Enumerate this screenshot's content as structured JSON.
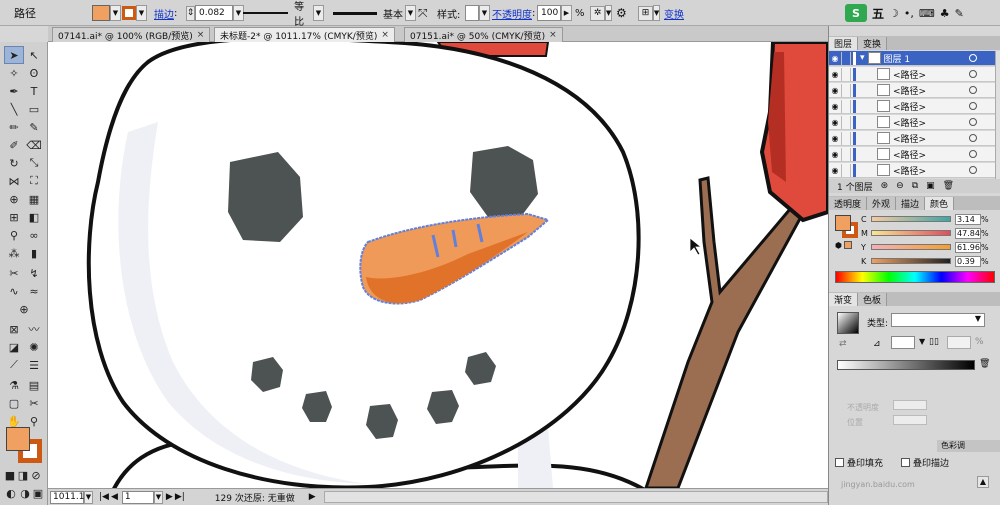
{
  "control_bar": {
    "object_type": "路径",
    "fill_color": "#f0a060",
    "stroke_color": "#cc5a14",
    "stroke_link": "描边",
    "stroke_weight": "0.082",
    "profile_label": "等比",
    "brush_label": "基本",
    "style_label": "样式:",
    "opacity_link": "不透明度",
    "opacity_value": "100",
    "opacity_unit": "%",
    "transform_link": "变换"
  },
  "ime": {
    "logo": "S",
    "mode": "五"
  },
  "doc_tabs": [
    {
      "label": "07141.ai* @ 100% (RGB/预览)",
      "close": "×",
      "active": false
    },
    {
      "label": "未标题-2* @ 1011.17% (CMYK/预览)",
      "close": "×",
      "active": true
    },
    {
      "label": "07151.ai* @ 50% (CMYK/预览)",
      "close": "×",
      "active": false
    }
  ],
  "layers_panel": {
    "tabs": [
      "图层",
      "变换"
    ],
    "top_layer": "图层 1",
    "rows": [
      "<路径>",
      "<路径>",
      "<路径>",
      "<路径>",
      "<路径>",
      "<路径>",
      "<路径>"
    ],
    "footer": "1 个图层"
  },
  "color_panel": {
    "tabs": [
      "透明度",
      "外观",
      "描边",
      "颜色"
    ],
    "channels": [
      {
        "label": "C",
        "value": "3.14"
      },
      {
        "label": "M",
        "value": "47.84"
      },
      {
        "label": "Y",
        "value": "61.96"
      },
      {
        "label": "K",
        "value": "0.39"
      }
    ],
    "unit": "%"
  },
  "gradient_panel": {
    "tabs": [
      "渐变",
      "色板"
    ],
    "type_label": "类型:",
    "pct": "%",
    "opacity_label": "不透明度",
    "position_label": "位置"
  },
  "attr_panel": {
    "tab": "色彩调",
    "overprint_fill": "叠印填充",
    "overprint_stroke": "叠印描边"
  },
  "status_bar": {
    "zoom": "1011.17",
    "artboard": "1",
    "undo_text": "129 次还原: 无重做"
  },
  "watermark": "jingyan.baidu.com"
}
